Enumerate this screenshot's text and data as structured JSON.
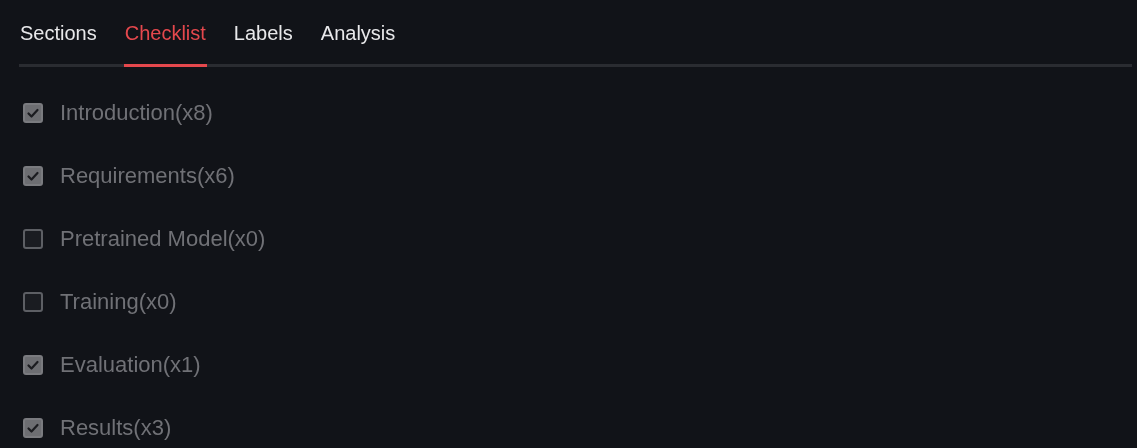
{
  "tabs": [
    {
      "label": "Sections",
      "selected": false
    },
    {
      "label": "Checklist",
      "selected": true
    },
    {
      "label": "Labels",
      "selected": false
    },
    {
      "label": "Analysis",
      "selected": false
    }
  ],
  "checklist": [
    {
      "label": "Introduction(x8)",
      "checked": true
    },
    {
      "label": "Requirements(x6)",
      "checked": true
    },
    {
      "label": "Pretrained Model(x0)",
      "checked": false
    },
    {
      "label": "Training(x0)",
      "checked": false
    },
    {
      "label": "Evaluation(x1)",
      "checked": true
    },
    {
      "label": "Results(x3)",
      "checked": true
    }
  ]
}
